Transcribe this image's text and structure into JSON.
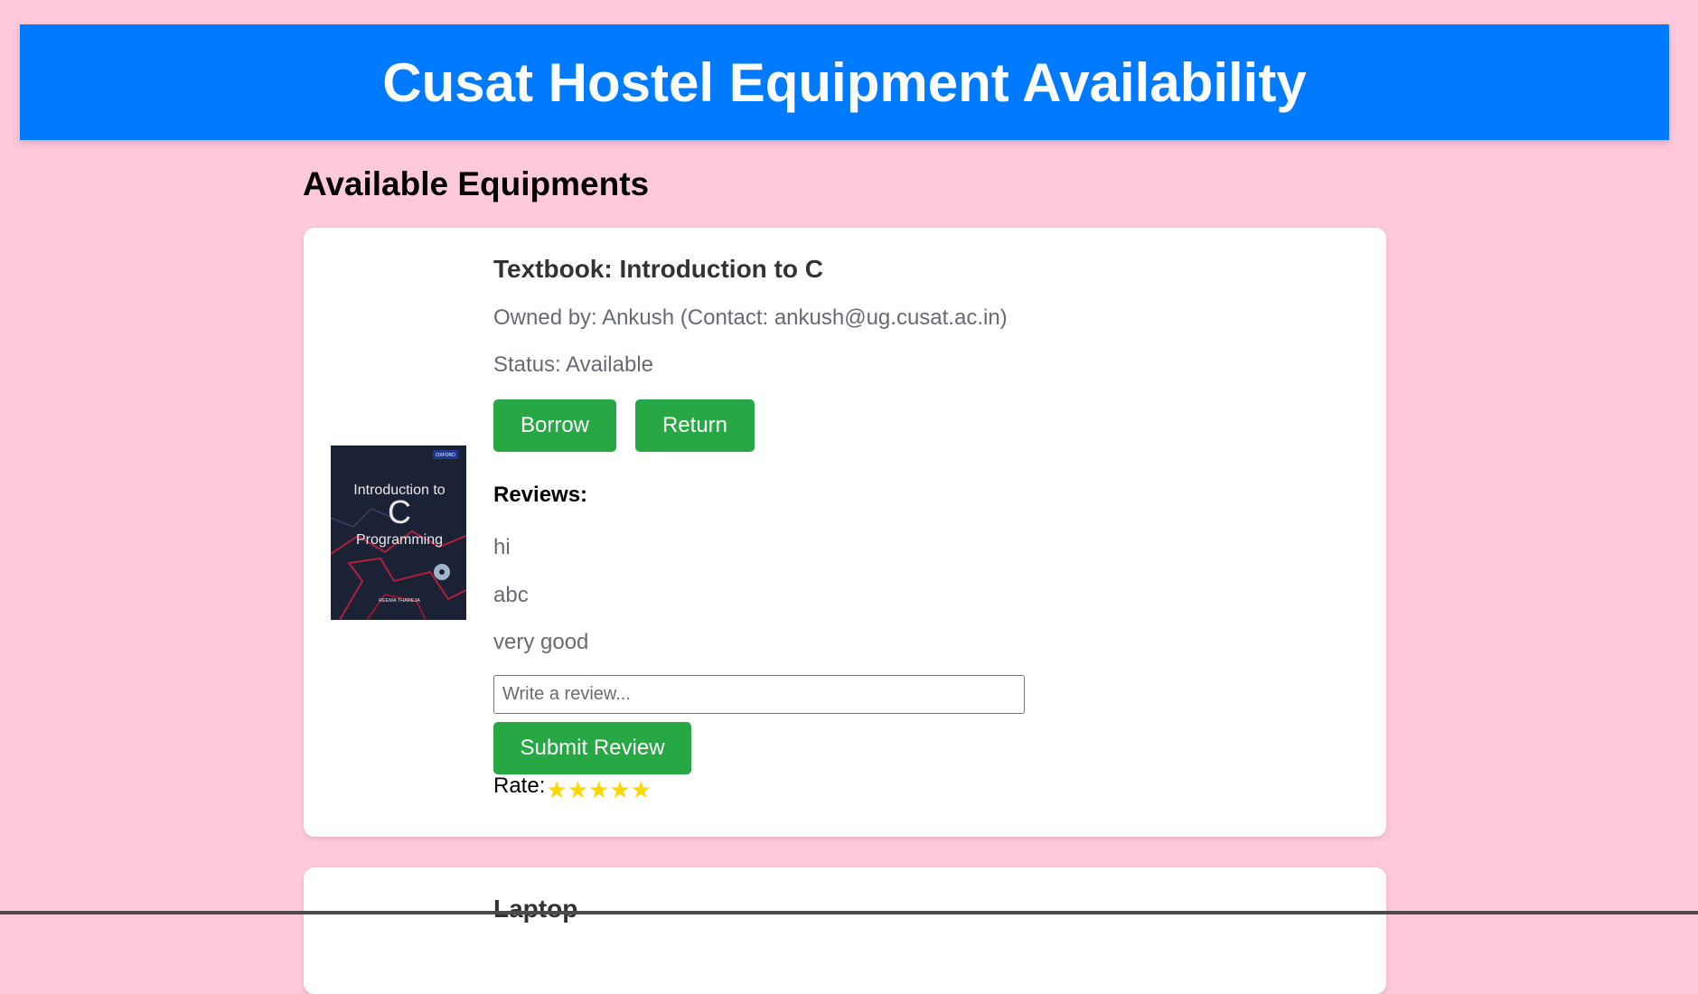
{
  "header": {
    "title": "Cusat Hostel Equipment Availability",
    "background": "#007bff"
  },
  "page": {
    "section_title": "Available Equipments",
    "background": "#ffc9dc"
  },
  "items": [
    {
      "title": "Textbook: Introduction to C",
      "owner_line": "Owned by: Ankush (Contact: ankush@ug.cusat.ac.in)",
      "status_line": "Status: Available",
      "borrow_label": "Borrow",
      "return_label": "Return",
      "reviews_heading": "Reviews:",
      "reviews": [
        "hi",
        "abc",
        "very good"
      ],
      "review_placeholder": "Write a review...",
      "submit_label": "Submit Review",
      "rate_label": "Rate:",
      "stars": [
        "★",
        "★",
        "★",
        "★",
        "★"
      ],
      "cover": {
        "publisher": "OXFORD",
        "line1": "Introduction to",
        "big_letter": "C",
        "line2": "Programming",
        "author": "REEMA THAREJA"
      }
    },
    {
      "title": "Laptop"
    }
  ],
  "colors": {
    "button": "#28a745",
    "star": "#ffd700",
    "muted_text": "#666b73"
  }
}
